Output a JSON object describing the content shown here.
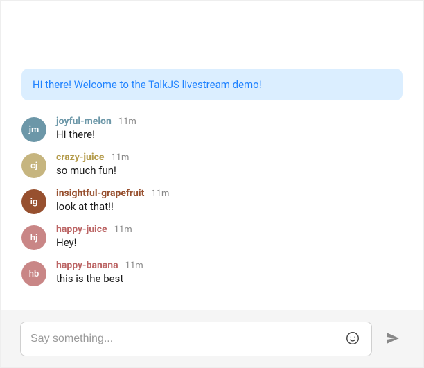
{
  "system_message": "Hi there! Welcome to the TalkJS livestream demo!",
  "messages": [
    {
      "initials": "jm",
      "avatar_bg": "#6C97A8",
      "name_color": "#6C97A8",
      "username": "joyful-melon",
      "time": "11m",
      "text": "Hi there!"
    },
    {
      "initials": "cj",
      "avatar_bg": "#C6B57F",
      "name_color": "#B49B4B",
      "username": "crazy-juice",
      "time": "11m",
      "text": "so much fun!"
    },
    {
      "initials": "ig",
      "avatar_bg": "#97502F",
      "name_color": "#97502F",
      "username": "insightful-grapefruit",
      "time": "11m",
      "text": "look at that!!"
    },
    {
      "initials": "hj",
      "avatar_bg": "#C98686",
      "name_color": "#BC6565",
      "username": "happy-juice",
      "time": "11m",
      "text": "Hey!"
    },
    {
      "initials": "hb",
      "avatar_bg": "#C98686",
      "name_color": "#BC6565",
      "username": "happy-banana",
      "time": "11m",
      "text": "this is the best"
    }
  ],
  "composer": {
    "placeholder": "Say something..."
  }
}
